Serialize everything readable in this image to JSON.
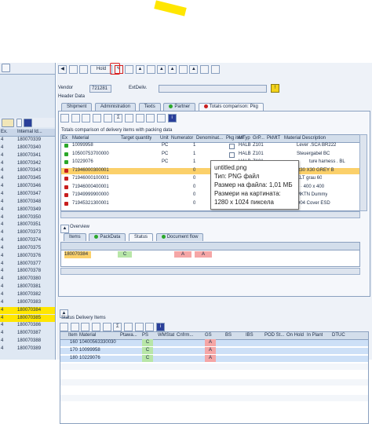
{
  "left_panel": {
    "header_cols": [
      "Ex.",
      "Internal Id..."
    ],
    "rows": [
      {
        "ex": "4",
        "id": "180070339"
      },
      {
        "ex": "4",
        "id": "180070340"
      },
      {
        "ex": "4",
        "id": "180070341"
      },
      {
        "ex": "4",
        "id": "180070342"
      },
      {
        "ex": "4",
        "id": "180070343"
      },
      {
        "ex": "4",
        "id": "180070345"
      },
      {
        "ex": "4",
        "id": "180070346"
      },
      {
        "ex": "4",
        "id": "180070347"
      },
      {
        "ex": "4",
        "id": "180070348"
      },
      {
        "ex": "4",
        "id": "180070349"
      },
      {
        "ex": "4",
        "id": "180070350"
      },
      {
        "ex": "4",
        "id": "180070351"
      },
      {
        "ex": "4",
        "id": "180070373"
      },
      {
        "ex": "4",
        "id": "180070374"
      },
      {
        "ex": "4",
        "id": "180070375"
      },
      {
        "ex": "4",
        "id": "180070376"
      },
      {
        "ex": "4",
        "id": "180070377"
      },
      {
        "ex": "4",
        "id": "180070378"
      },
      {
        "ex": "4",
        "id": "180070380"
      },
      {
        "ex": "4",
        "id": "180070381"
      },
      {
        "ex": "4",
        "id": "180070382"
      },
      {
        "ex": "4",
        "id": "180070383"
      },
      {
        "ex": "4",
        "id": "180070384"
      },
      {
        "ex": "4",
        "id": "180070385"
      },
      {
        "ex": "4",
        "id": "180070386"
      },
      {
        "ex": "4",
        "id": "180070387"
      },
      {
        "ex": "4",
        "id": "180070388"
      },
      {
        "ex": "4",
        "id": "180070389"
      }
    ]
  },
  "toolbar": {
    "hold_label": "Hold"
  },
  "header": {
    "vendor_label": "Vendor",
    "vendor_value": "721281",
    "extdeliv_label": "ExtDeliv.",
    "header_data_label": "Header Data"
  },
  "top_tabs": [
    "Shipment",
    "Administration",
    "Texts",
    "Partner",
    "Totals comparison: Pkg"
  ],
  "packing": {
    "title": "Totals comparison of delivery items with packing data",
    "columns": [
      "Ex",
      "Material",
      "Target quantity",
      "Unit",
      "Numerator",
      "Denominat...",
      "Pkg item",
      "MTyp",
      "GrP...",
      "PkMtT",
      "Material Description"
    ],
    "rows": [
      {
        "status": "green",
        "material": "10099958",
        "unit": "PC",
        "num": "1",
        "mtyp": "HALB",
        "grp": "Z101",
        "desc": "Lever .SCA BR222"
      },
      {
        "status": "green",
        "material": "10500753700000",
        "unit": "PC",
        "num": "1",
        "mtyp": "HALB",
        "grp": "Z101",
        "desc": "Steuergabel BC"
      },
      {
        "status": "green",
        "material": "10229076",
        "unit": "PC",
        "num": "1",
        "mtyp": "HALB",
        "grp": "Z101",
        "desc": ""
      },
      {
        "status": "red",
        "material": "71946000300001",
        "unit": "",
        "num": "0",
        "mtyp": "",
        "grp": "",
        "desc": "R30 X30 GREY B"
      },
      {
        "status": "red",
        "material": "71946000100001",
        "unit": "",
        "num": "0",
        "mtyp": "",
        "grp": "",
        "desc": "KLT grau 60"
      },
      {
        "status": "red",
        "material": "71946000400001",
        "unit": "",
        "num": "0",
        "mtyp": "",
        "grp": "",
        "desc": "4 · 400 x 400"
      },
      {
        "status": "red",
        "material": "71949999900000",
        "unit": "",
        "num": "0",
        "mtyp": "",
        "grp": "",
        "desc": "MKTN Dummy"
      },
      {
        "status": "red",
        "material": "71945321300001",
        "unit": "",
        "num": "0",
        "mtyp": "",
        "grp": "",
        "desc": "D04 Cover ESD"
      }
    ],
    "extra_desc": "ture harness . BL"
  },
  "tooltip": {
    "line1": "untitled.png",
    "line2": "Тип: PNG файл",
    "line3": "Размер на файла: 1,01 МБ",
    "line4": "Размери на картината:",
    "line5": "1280 x 1024 пиксела"
  },
  "overview": {
    "label": "Overview",
    "tabs": [
      "Items",
      "PackData",
      "Status",
      "Document flow"
    ],
    "row_id": "180070384",
    "row_cells": [
      "C",
      "A",
      "A"
    ]
  },
  "status_items": {
    "title": "Status Delivery Items",
    "columns": [
      "Item",
      "Material",
      "Ptawa...",
      "PS",
      "WMStat",
      "Cnfrm...",
      "GS",
      "BS",
      "IBS",
      "POD St...",
      "On Hold",
      "In Plant",
      "DTUC"
    ],
    "rows": [
      {
        "item": "160",
        "material": "10400563330030",
        "ps": "C",
        "gs": "A"
      },
      {
        "item": "170",
        "material": "10099958",
        "ps": "C",
        "gs": "A"
      },
      {
        "item": "180",
        "material": "10229076",
        "ps": "C",
        "gs": "A"
      }
    ]
  },
  "colors": {
    "highlight": "#ffe600",
    "ok": "#2aa82a",
    "error": "#c81e1e",
    "pink": "#f5a6a6",
    "green_cell": "#b8e6a8",
    "row_select": "#fbd06a"
  }
}
